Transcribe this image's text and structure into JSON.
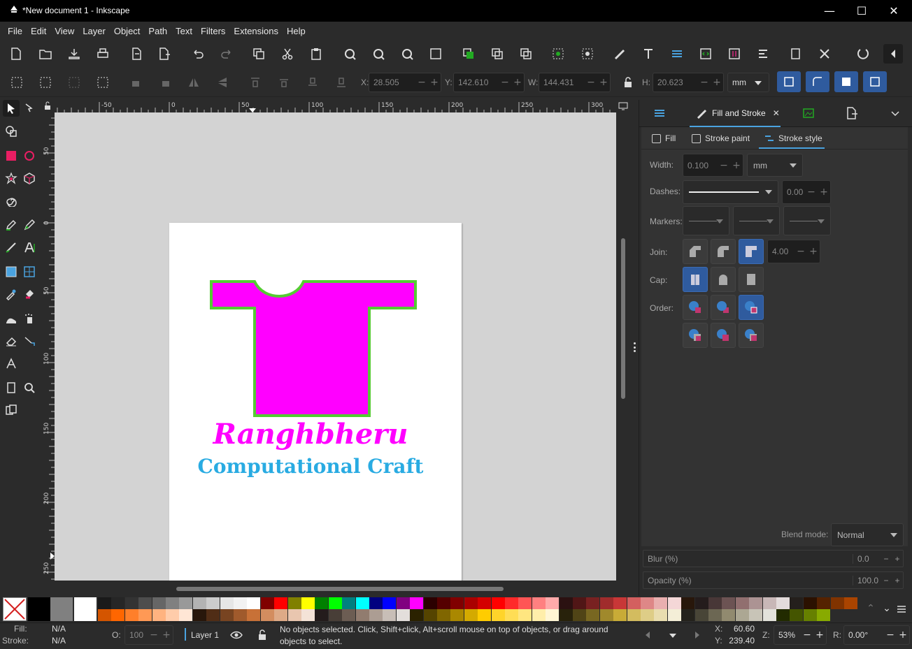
{
  "window": {
    "title": "*New document 1 - Inkscape",
    "minimize": "—",
    "maximize": "☐",
    "close": "✕"
  },
  "menu": [
    "File",
    "Edit",
    "View",
    "Layer",
    "Object",
    "Path",
    "Text",
    "Filters",
    "Extensions",
    "Help"
  ],
  "controls": {
    "x_label": "X:",
    "x_value": "28.505",
    "y_label": "Y:",
    "y_value": "142.610",
    "w_label": "W:",
    "w_value": "144.431",
    "h_label": "H:",
    "h_value": "20.623",
    "unit": "mm"
  },
  "ruler_h": [
    "-50",
    "0",
    "50",
    "100",
    "150",
    "200",
    "250",
    "300"
  ],
  "ruler_v": [
    "50",
    "0",
    "50",
    "100",
    "150",
    "200",
    "250"
  ],
  "artwork": {
    "line1": "Ranghbheru",
    "line2": "Computational Craft",
    "shirt_fill": "#ff00ff",
    "shirt_stroke": "#55cc33",
    "line2_color": "#29abe2"
  },
  "dock": {
    "tab_label": "Fill and Stroke",
    "subtabs": {
      "fill": "Fill",
      "stroke_paint": "Stroke paint",
      "stroke_style": "Stroke style"
    },
    "width_label": "Width:",
    "width_value": "0.100",
    "width_unit": "mm",
    "dashes_label": "Dashes:",
    "dashes_offset": "0.00",
    "markers_label": "Markers:",
    "join_label": "Join:",
    "join_limit": "4.00",
    "cap_label": "Cap:",
    "order_label": "Order:",
    "blend_label": "Blend mode:",
    "blend_value": "Normal",
    "blur_label": "Blur (%)",
    "blur_value": "0.0",
    "opacity_label": "Opacity (%)",
    "opacity_value": "100.0"
  },
  "status": {
    "fill_label": "Fill:",
    "fill_value": "N/A",
    "stroke_label": "Stroke:",
    "stroke_value": "N/A",
    "o_label": "O:",
    "o_value": "100",
    "layer": "Layer 1",
    "message": "No objects selected. Click, Shift+click, Alt+scroll mouse on top of objects, or drag around objects to select.",
    "cursor_x_label": "X:",
    "cursor_x": "60.60",
    "cursor_y_label": "Y:",
    "cursor_y": "239.40",
    "zoom_label": "Z:",
    "zoom": "53%",
    "rotation_label": "R:",
    "rotation": "0.00°"
  },
  "palette_row1": [
    "#1a1a1a",
    "#262626",
    "#333333",
    "#4d4d4d",
    "#666666",
    "#808080",
    "#999999",
    "#b3b3b3",
    "#cccccc",
    "#e6e6e6",
    "#f2f2f2",
    "#ffffff",
    "#800000",
    "#ff0000",
    "#808000",
    "#ffff00",
    "#008000",
    "#00ff00",
    "#008080",
    "#00ffff",
    "#000080",
    "#0000ff",
    "#800080",
    "#ff00ff",
    "#2b0000",
    "#550000",
    "#800000",
    "#aa0000",
    "#d40000",
    "#ff0000",
    "#ff2a2a",
    "#ff5555",
    "#ff8080",
    "#ffaaaa",
    "#2b1111",
    "#501616",
    "#782121",
    "#a02c2c",
    "#c83737",
    "#d35f5f",
    "#de8787",
    "#e9afaf",
    "#f4d7d7",
    "#28170b",
    "#241c1c",
    "#483737",
    "#6c5353",
    "#916f6f",
    "#ac9393",
    "#c8b7b7",
    "#e3dbdb",
    "#241f1c",
    "#2b1100",
    "#552200",
    "#803300",
    "#aa4400"
  ],
  "palette_row2": [
    "#d45500",
    "#ff6600",
    "#ff7f2a",
    "#ff9955",
    "#ffb380",
    "#ffccaa",
    "#ffe6d5",
    "#28170b",
    "#502d16",
    "#784421",
    "#a05a2c",
    "#c87137",
    "#d38d5f",
    "#deaa87",
    "#e9c6af",
    "#f4e3d7",
    "#241c1c",
    "#483e37",
    "#6c5d53",
    "#917c6f",
    "#ac9d93",
    "#c8beb7",
    "#e3dedb",
    "#2b2200",
    "#554400",
    "#806600",
    "#aa8800",
    "#d4aa00",
    "#ffcc00",
    "#ffd42a",
    "#ffdd55",
    "#ffe680",
    "#ffeeaa",
    "#fff6d5",
    "#28220b",
    "#504416",
    "#786721",
    "#a0892c",
    "#c8ab37",
    "#d3bc5f",
    "#decd87",
    "#e9ddaf",
    "#f4eed7",
    "#24221c",
    "#484537",
    "#6c6753",
    "#918a6f",
    "#aca793",
    "#c8c4b7",
    "#e3e2db",
    "#222b00",
    "#445500",
    "#668000",
    "#88aa00"
  ]
}
